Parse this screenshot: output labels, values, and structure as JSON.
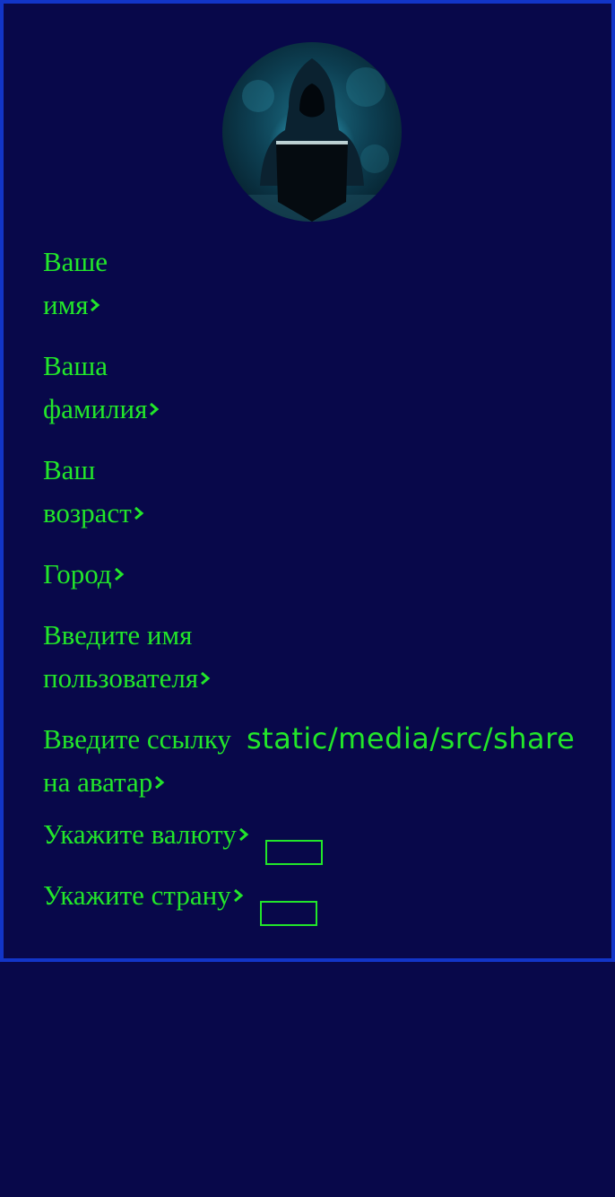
{
  "colors": {
    "background": "#08084a",
    "border": "#1235c8",
    "text": "#22e62a"
  },
  "avatar": {
    "icon": "hooded-hacker-avatar"
  },
  "fields": {
    "first_name": {
      "line1": "Ваше",
      "line2": "имя"
    },
    "last_name": {
      "line1": "Ваша",
      "line2": "фамилия"
    },
    "age": {
      "line1": "Ваш",
      "line2": "возраст"
    },
    "city": {
      "line1": "Город"
    },
    "username": {
      "line1": "Введите имя",
      "line2": "пользователя"
    },
    "avatar_link": {
      "line1": "Введите ссылку",
      "line2": "на аватар",
      "value": "static/media/src/share"
    },
    "currency": {
      "line1": "Укажите валюту"
    },
    "country": {
      "line1": "Укажите страну"
    }
  }
}
